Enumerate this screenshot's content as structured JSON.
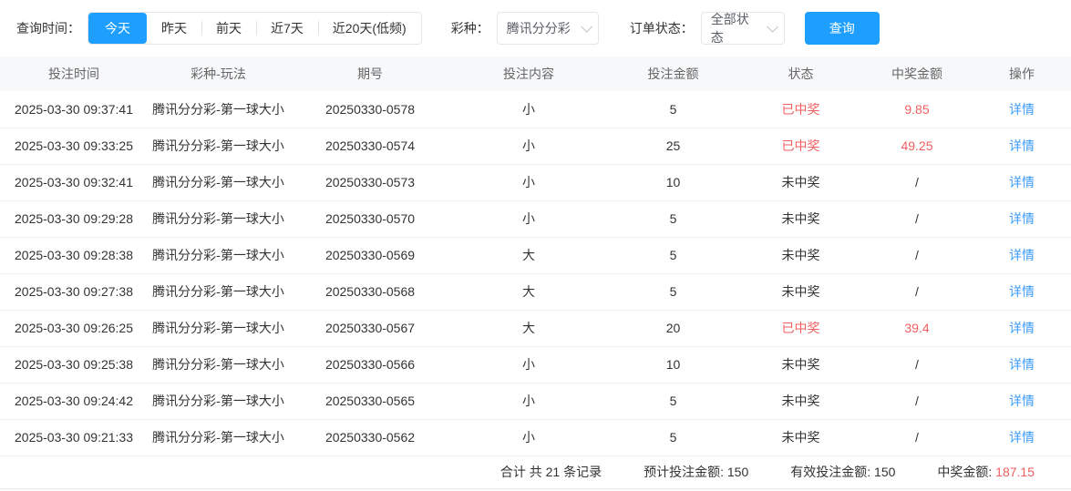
{
  "filters": {
    "time_label": "查询时间：",
    "time_options": [
      {
        "label": "今天",
        "active": true
      },
      {
        "label": "昨天",
        "active": false
      },
      {
        "label": "前天",
        "active": false
      },
      {
        "label": "近7天",
        "active": false
      },
      {
        "label": "近20天(低频)",
        "active": false
      }
    ],
    "lottery_label": "彩种：",
    "lottery_value": "腾讯分分彩",
    "status_label": "订单状态：",
    "status_value": "全部状态",
    "search_button": "查询"
  },
  "table": {
    "headers": [
      "投注时间",
      "彩种-玩法",
      "期号",
      "投注内容",
      "投注金额",
      "状态",
      "中奖金额",
      "操作"
    ],
    "action_label": "详情",
    "rows": [
      {
        "time": "2025-03-30 09:37:41",
        "game": "腾讯分分彩-第一球大小",
        "issue": "20250330-0578",
        "content": "小",
        "amount": "5",
        "status": "已中奖",
        "win": "9.85",
        "won": true
      },
      {
        "time": "2025-03-30 09:33:25",
        "game": "腾讯分分彩-第一球大小",
        "issue": "20250330-0574",
        "content": "小",
        "amount": "25",
        "status": "已中奖",
        "win": "49.25",
        "won": true
      },
      {
        "time": "2025-03-30 09:32:41",
        "game": "腾讯分分彩-第一球大小",
        "issue": "20250330-0573",
        "content": "小",
        "amount": "10",
        "status": "未中奖",
        "win": "/",
        "won": false
      },
      {
        "time": "2025-03-30 09:29:28",
        "game": "腾讯分分彩-第一球大小",
        "issue": "20250330-0570",
        "content": "小",
        "amount": "5",
        "status": "未中奖",
        "win": "/",
        "won": false
      },
      {
        "time": "2025-03-30 09:28:38",
        "game": "腾讯分分彩-第一球大小",
        "issue": "20250330-0569",
        "content": "大",
        "amount": "5",
        "status": "未中奖",
        "win": "/",
        "won": false
      },
      {
        "time": "2025-03-30 09:27:38",
        "game": "腾讯分分彩-第一球大小",
        "issue": "20250330-0568",
        "content": "大",
        "amount": "5",
        "status": "未中奖",
        "win": "/",
        "won": false
      },
      {
        "time": "2025-03-30 09:26:25",
        "game": "腾讯分分彩-第一球大小",
        "issue": "20250330-0567",
        "content": "大",
        "amount": "20",
        "status": "已中奖",
        "win": "39.4",
        "won": true
      },
      {
        "time": "2025-03-30 09:25:38",
        "game": "腾讯分分彩-第一球大小",
        "issue": "20250330-0566",
        "content": "小",
        "amount": "10",
        "status": "未中奖",
        "win": "/",
        "won": false
      },
      {
        "time": "2025-03-30 09:24:42",
        "game": "腾讯分分彩-第一球大小",
        "issue": "20250330-0565",
        "content": "小",
        "amount": "5",
        "status": "未中奖",
        "win": "/",
        "won": false
      },
      {
        "time": "2025-03-30 09:21:33",
        "game": "腾讯分分彩-第一球大小",
        "issue": "20250330-0562",
        "content": "小",
        "amount": "5",
        "status": "未中奖",
        "win": "/",
        "won": false
      }
    ]
  },
  "summary": {
    "total_label": "合计 共 21 条记录",
    "expected_label": "预计投注金额: 150",
    "valid_label": "有效投注金额: 150",
    "win_label": "中奖金额:",
    "win_value": "187.15"
  },
  "colors": {
    "accent_blue": "#1e9fff",
    "link_blue": "#3a9bfc",
    "status_red": "#f25e5e"
  }
}
